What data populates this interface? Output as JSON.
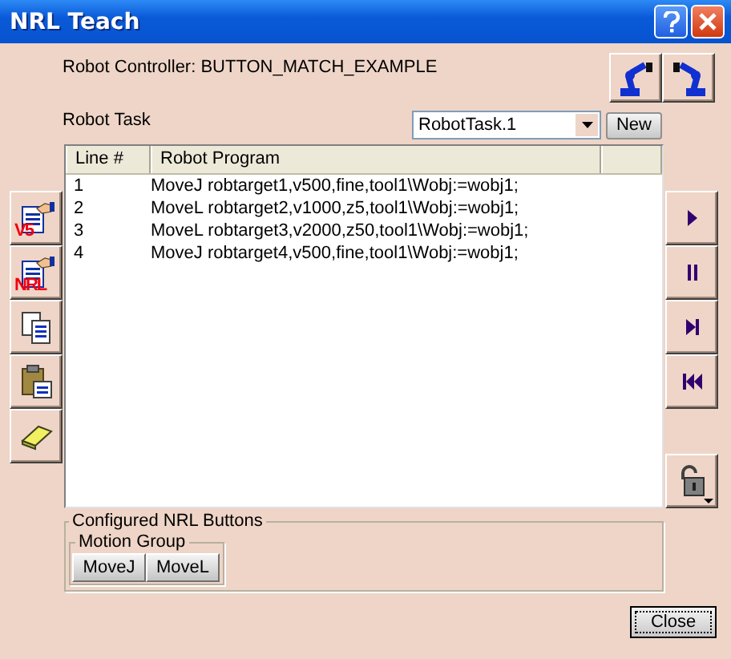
{
  "window": {
    "title": "NRL Teach"
  },
  "controller_label": "Robot Controller: BUTTON_MATCH_EXAMPLE",
  "robot_buttons": [
    {
      "kind": "robot-left"
    },
    {
      "kind": "robot-right"
    }
  ],
  "task": {
    "label": "Robot Task",
    "value": "RobotTask.1",
    "new_button": "New"
  },
  "table": {
    "columns": [
      "Line #",
      "Robot Program"
    ],
    "rows": [
      [
        "1",
        "MoveJ robtarget1,v500,fine,tool1\\Wobj:=wobj1;"
      ],
      [
        "2",
        "MoveL robtarget2,v1000,z5,tool1\\Wobj:=wobj1;"
      ],
      [
        "3",
        "MoveL robtarget3,v2000,z50,tool1\\Wobj:=wobj1;"
      ],
      [
        "4",
        "MoveJ robtarget4,v500,fine,tool1\\Wobj:=wobj1;"
      ]
    ]
  },
  "left_tools": [
    {
      "kind": "document",
      "badge": "V5"
    },
    {
      "kind": "document",
      "badge": "NRL"
    },
    {
      "kind": "copy"
    },
    {
      "kind": "paste"
    },
    {
      "kind": "eraser"
    }
  ],
  "right_tools": [
    {
      "kind": "play"
    },
    {
      "kind": "pause"
    },
    {
      "kind": "step"
    },
    {
      "kind": "rewind"
    }
  ],
  "lock_button": {
    "kind": "lock"
  },
  "nrl_buttons": {
    "title": "Configured NRL Buttons",
    "groups": [
      {
        "title": "Motion Group",
        "buttons": [
          "MoveJ",
          "MoveL"
        ]
      }
    ]
  },
  "close_button": "Close"
}
